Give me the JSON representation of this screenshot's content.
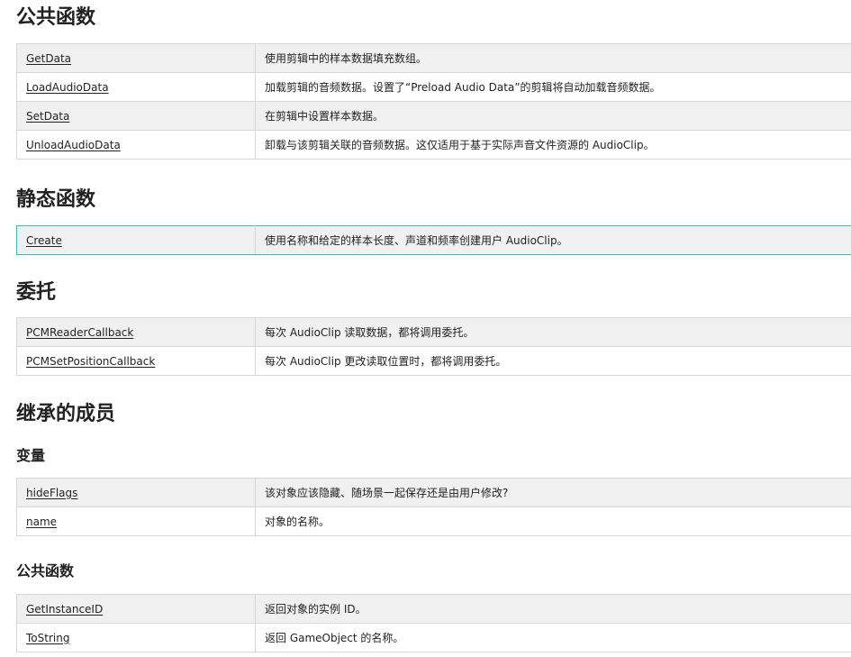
{
  "sections": {
    "public_functions": {
      "title": "公共函数",
      "rows": [
        {
          "name": "GetData",
          "desc": "使用剪辑中的样本数据填充数组。"
        },
        {
          "name": "LoadAudioData",
          "desc": "加载剪辑的音频数据。设置了“Preload Audio Data”的剪辑将自动加载音频数据。"
        },
        {
          "name": "SetData",
          "desc": "在剪辑中设置样本数据。"
        },
        {
          "name": "UnloadAudioData",
          "desc": "卸载与该剪辑关联的音频数据。这仅适用于基于实际声音文件资源的 AudioClip。"
        }
      ]
    },
    "static_functions": {
      "title": "静态函数",
      "rows": [
        {
          "name": "Create",
          "desc": "使用名称和给定的样本长度、声道和频率创建用户 AudioClip。"
        }
      ]
    },
    "delegates": {
      "title": "委托",
      "rows": [
        {
          "name": "PCMReaderCallback",
          "desc": "每次 AudioClip 读取数据，都将调用委托。"
        },
        {
          "name": "PCMSetPositionCallback",
          "desc": "每次 AudioClip 更改读取位置时，都将调用委托。"
        }
      ]
    },
    "inherited": {
      "title": "继承的成员",
      "variables": {
        "title": "变量",
        "rows": [
          {
            "name": "hideFlags",
            "desc": "该对象应该隐藏、随场景一起保存还是由用户修改?"
          },
          {
            "name": "name",
            "desc": "对象的名称。"
          }
        ]
      },
      "public_functions": {
        "title": "公共函数",
        "rows": [
          {
            "name": "GetInstanceID",
            "desc": "返回对象的实例 ID。"
          },
          {
            "name": "ToString",
            "desc": "返回 GameObject 的名称。"
          }
        ]
      }
    }
  },
  "colors": {
    "highlight_border": "#36c0c3",
    "row_alt": "#f0f0f0",
    "border": "#d7d7d7"
  }
}
